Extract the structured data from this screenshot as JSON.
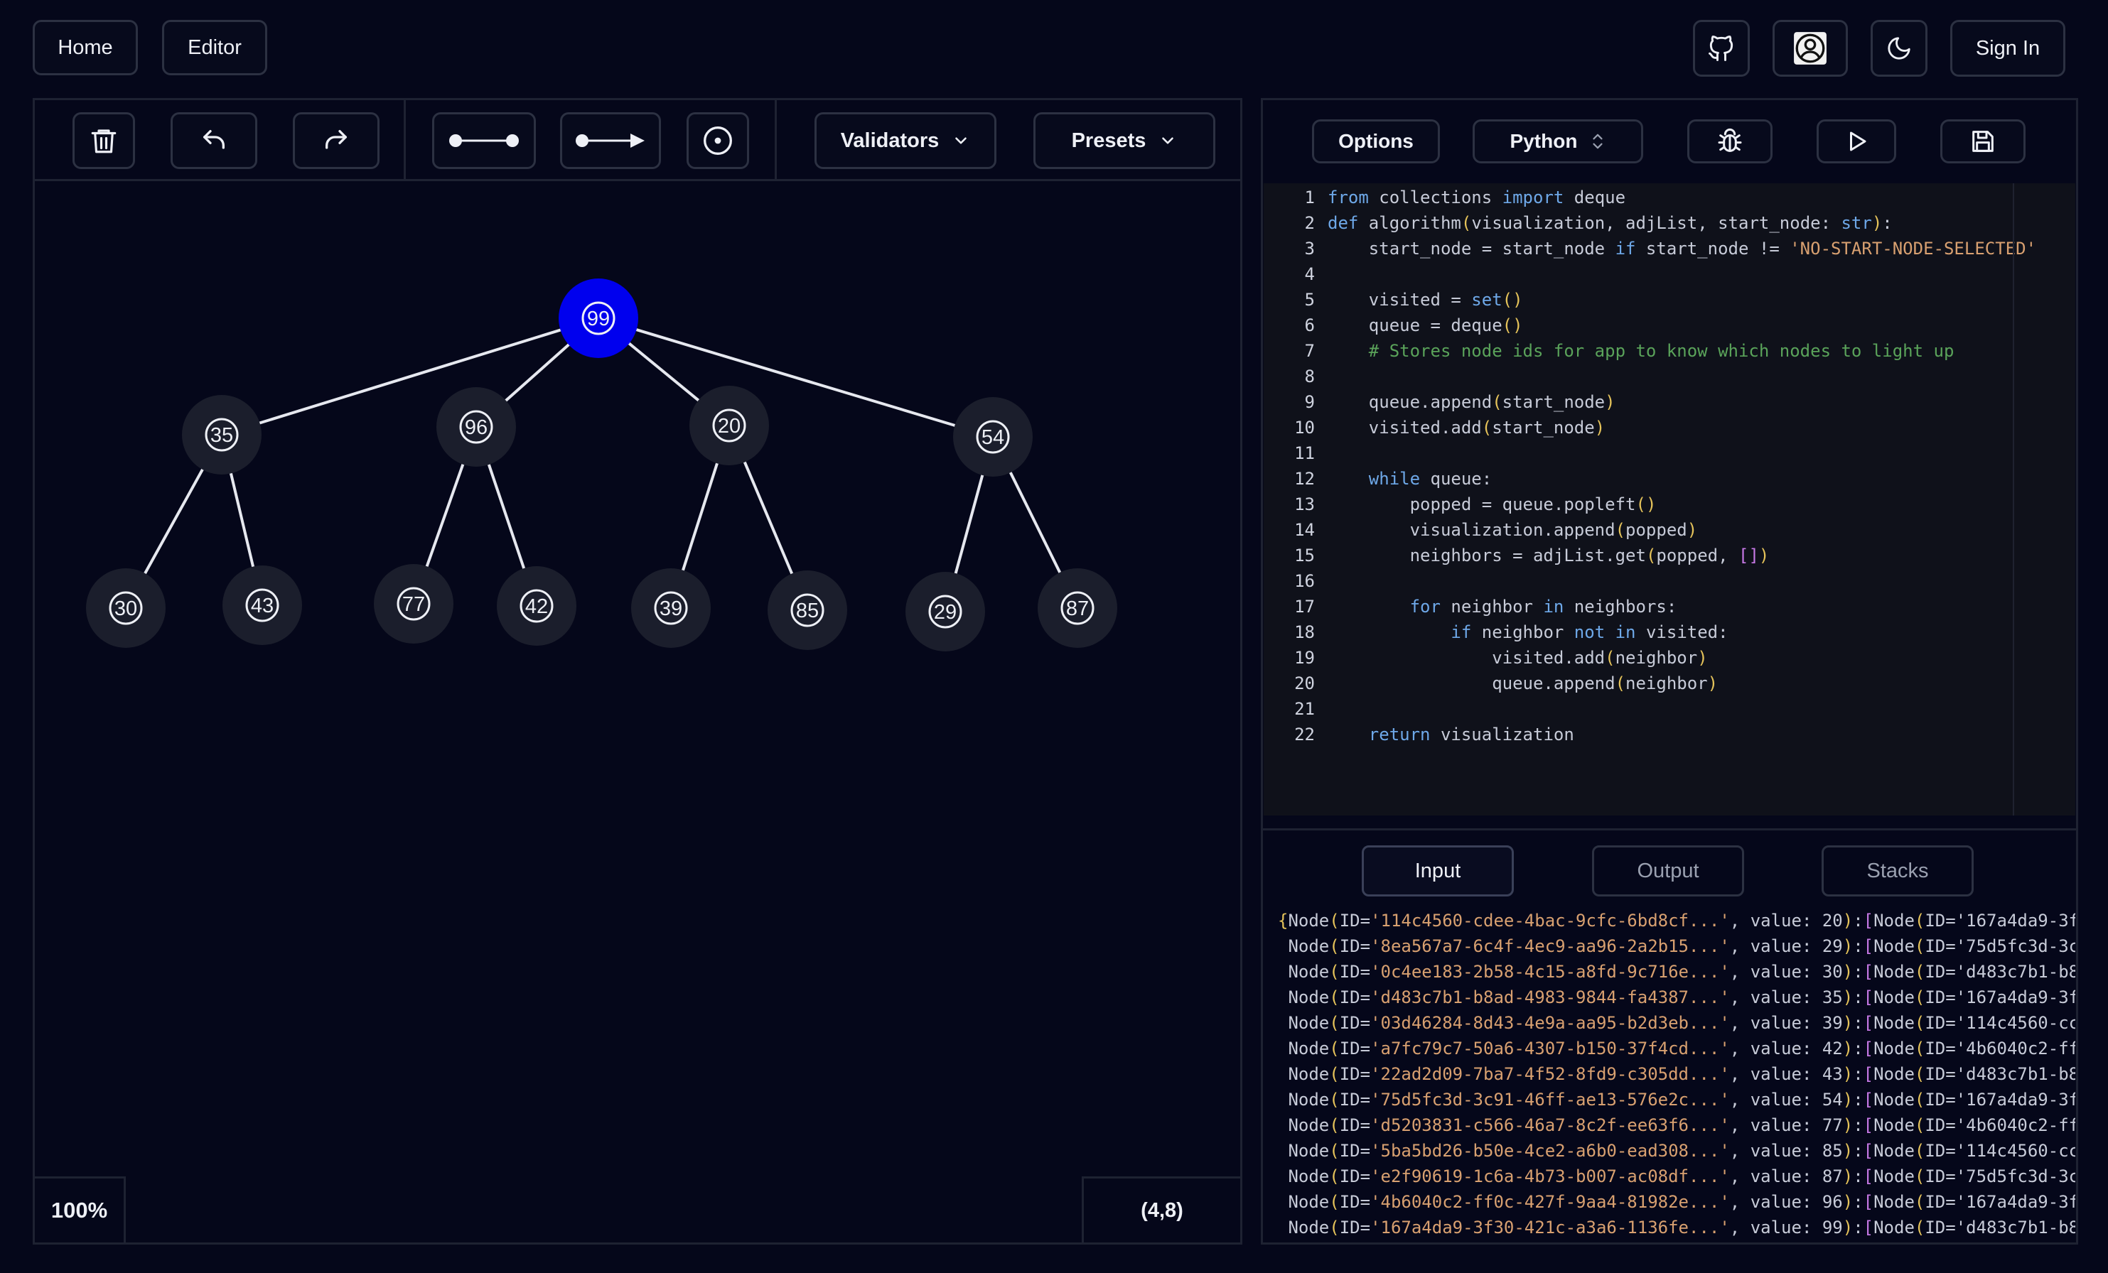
{
  "nav": {
    "home": "Home",
    "editor": "Editor",
    "sign_in": "Sign In"
  },
  "toolbar": {
    "validators": "Validators",
    "presets": "Presets",
    "icons": [
      "trash-icon",
      "undo-icon",
      "redo-icon",
      "undirected-edge-icon",
      "directed-edge-icon",
      "node-icon",
      "chevron-down-icon"
    ]
  },
  "editor_toolbar": {
    "options": "Options",
    "language": "Python"
  },
  "canvas": {
    "zoom": "100%",
    "coords": "(4,8)"
  },
  "graph": {
    "root": "99",
    "level1": [
      "35",
      "96",
      "20",
      "54"
    ],
    "level2": [
      "30",
      "43",
      "77",
      "42",
      "39",
      "85",
      "29",
      "87"
    ],
    "selected": "99",
    "colors": {
      "selected": "#0000ee",
      "node_halo": "#1b1e2c",
      "edge": "#e6e8ef"
    }
  },
  "code": [
    "from collections import deque",
    "def algorithm(visualization, adjList, start_node: str):",
    "    start_node = start_node if start_node != 'NO-START-NODE-SELECTED'",
    "",
    "    visited = set()",
    "    queue = deque()",
    "    # Stores node ids for app to know which nodes to light up",
    "",
    "    queue.append(start_node)",
    "    visited.add(start_node)",
    "",
    "    while queue:",
    "        popped = queue.popleft()",
    "        visualization.append(popped)",
    "        neighbors = adjList.get(popped, [])",
    "",
    "        for neighbor in neighbors:",
    "            if neighbor not in visited:",
    "                visited.add(neighbor)",
    "                queue.append(neighbor)",
    "",
    "    return visualization"
  ],
  "io_tabs": [
    "Input",
    "Output",
    "Stacks"
  ],
  "input_rows": [
    "{Node(ID='114c4560-cdee-4bac-9cfc-6bd8cf...', value: 20):[Node(ID='167a4da9-3f",
    " Node(ID='8ea567a7-6c4f-4ec9-aa96-2a2b15...', value: 29):[Node(ID='75d5fc3d-3c",
    " Node(ID='0c4ee183-2b58-4c15-a8fd-9c716e...', value: 30):[Node(ID='d483c7b1-b8",
    " Node(ID='d483c7b1-b8ad-4983-9844-fa4387...', value: 35):[Node(ID='167a4da9-3f",
    " Node(ID='03d46284-8d43-4e9a-aa95-b2d3eb...', value: 39):[Node(ID='114c4560-cc",
    " Node(ID='a7fc79c7-50a6-4307-b150-37f4cd...', value: 42):[Node(ID='4b6040c2-ff",
    " Node(ID='22ad2d09-7ba7-4f52-8fd9-c305dd...', value: 43):[Node(ID='d483c7b1-b8",
    " Node(ID='75d5fc3d-3c91-46ff-ae13-576e2c...', value: 54):[Node(ID='167a4da9-3f",
    " Node(ID='d5203831-c566-46a7-8c2f-ee63f6...', value: 77):[Node(ID='4b6040c2-ff",
    " Node(ID='5ba5bd26-b50e-4ce2-a6b0-ead308...', value: 85):[Node(ID='114c4560-cc",
    " Node(ID='e2f90619-1c6a-4b73-b007-ac08df...', value: 87):[Node(ID='75d5fc3d-3c",
    " Node(ID='4b6040c2-ff0c-427f-9aa4-81982e...', value: 96):[Node(ID='167a4da9-3f",
    " Node(ID='167a4da9-3f30-421c-a3a6-1136fe...', value: 99):[Node(ID='d483c7b1-b8"
  ]
}
